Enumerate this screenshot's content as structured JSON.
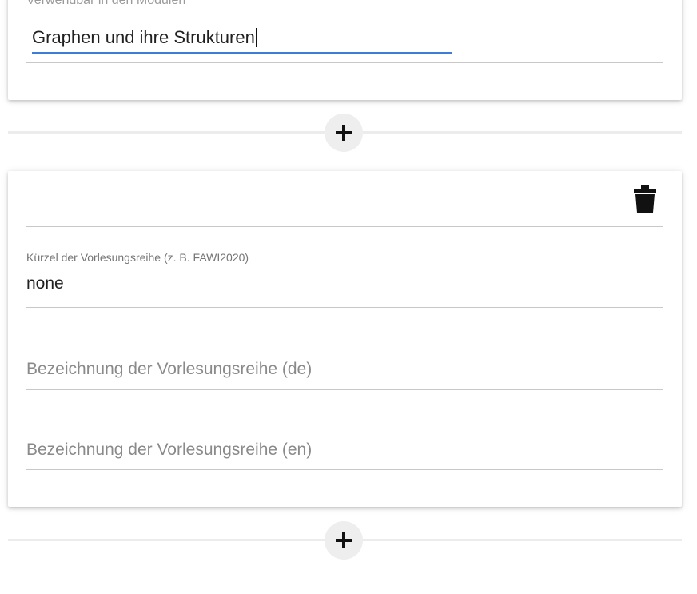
{
  "module_section": {
    "field_label": "Verwendbar in den Modulen",
    "input_value": "Graphen und ihre Strukturen"
  },
  "series_card": {
    "short_label": "Kürzel der Vorlesungsreihe (z. B. FAWI2020)",
    "short_value": "none",
    "name_de_placeholder": "Bezeichnung der Vorlesungsreihe (de)",
    "name_en_placeholder": "Bezeichnung der Vorlesungsreihe (en)"
  },
  "icons": {
    "add": "plus-icon",
    "delete": "trash-icon"
  },
  "colors": {
    "focus_underline": "#3b7dd8",
    "divider": "#ececec",
    "add_button_bg": "#eeeeee"
  }
}
